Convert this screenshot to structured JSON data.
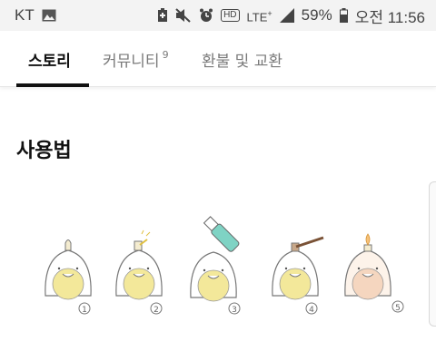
{
  "status_bar": {
    "carrier": "KT",
    "network": "LTE",
    "battery": "59%",
    "time": "오전 11:56",
    "hd_label": "HD"
  },
  "tabs": [
    {
      "label": "스토리",
      "active": true
    },
    {
      "label": "커뮤니티",
      "count": "9",
      "active": false
    },
    {
      "label": "환불 및 교환",
      "active": false
    }
  ],
  "main": {
    "section_title": "사용법",
    "steps": [
      "1",
      "2",
      "3",
      "4",
      "5"
    ]
  },
  "colors": {
    "accent": "#111111",
    "inactive_tab": "#7a7a7a",
    "illustration_yellow": "#f3e89a",
    "illustration_peach": "#f5d6bf",
    "tube_teal": "#7fd3c4"
  }
}
